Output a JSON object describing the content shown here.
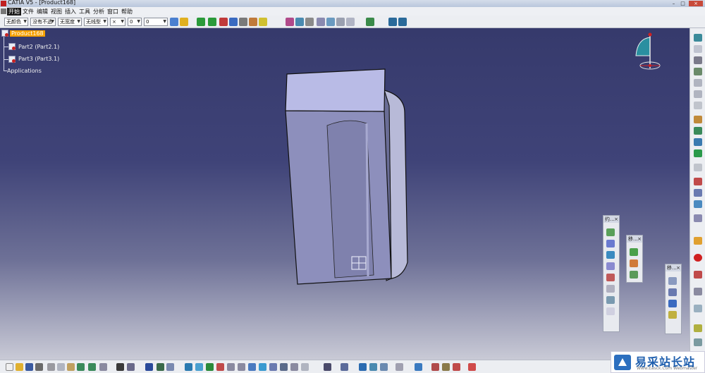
{
  "window": {
    "title": "CATIA V5 - [Product168]",
    "min": "–",
    "max": "□",
    "close": "×"
  },
  "menu": {
    "items": [
      "开始",
      "文件",
      "编辑",
      "视图",
      "插入",
      "工具",
      "分析",
      "窗口",
      "帮助"
    ],
    "active_index": 0
  },
  "graphic_properties": {
    "color": "无颜色",
    "transparency": "没有不透",
    "line_thickness": "无宽度",
    "line_type": "无线型",
    "point_symbol": "×",
    "layer": "0",
    "render_style": "0"
  },
  "tree": {
    "root": "Product168",
    "children": [
      "Part2 (Part2.1)",
      "Part3 (Part3.1)"
    ],
    "applications": "Applications"
  },
  "floating_toolbars": [
    {
      "title": "约..."
    },
    {
      "title": "移..."
    },
    {
      "title": "移..."
    }
  ],
  "watermark": {
    "name": "易采站长站",
    "tagline": "Www.Easck.Com  Webmaster"
  },
  "colors": {
    "accent_selection": "#f5a000",
    "viewport_top": "#363a6c",
    "viewport_bottom": "#c9cad6",
    "part_face": "#9a9ccc"
  }
}
